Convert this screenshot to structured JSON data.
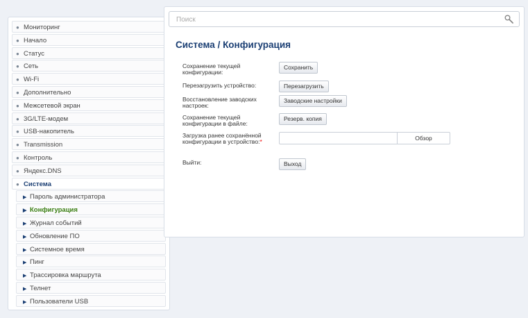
{
  "sidebar": {
    "items": [
      {
        "label": "Мониторинг"
      },
      {
        "label": "Начало"
      },
      {
        "label": "Статус"
      },
      {
        "label": "Сеть"
      },
      {
        "label": "Wi-Fi"
      },
      {
        "label": "Дополнительно"
      },
      {
        "label": "Межсетевой экран"
      },
      {
        "label": "3G/LTE-модем"
      },
      {
        "label": "USB-накопитель"
      },
      {
        "label": "Transmission"
      },
      {
        "label": "Контроль"
      },
      {
        "label": "Яндекс.DNS"
      },
      {
        "label": "Система"
      },
      {
        "label": "Пароль администратора"
      },
      {
        "label": "Конфигурация"
      },
      {
        "label": "Журнал событий"
      },
      {
        "label": "Обновление ПО"
      },
      {
        "label": "Системное время"
      },
      {
        "label": "Пинг"
      },
      {
        "label": "Трассировка маршрута"
      },
      {
        "label": "Телнет"
      },
      {
        "label": "Пользователи USB"
      }
    ]
  },
  "search": {
    "placeholder": "Поиск"
  },
  "page": {
    "title": "Система /  Конфигурация"
  },
  "form": {
    "save_label": "Сохранение текущей конфигурации:",
    "save_button": "Сохранить",
    "reboot_label": "Перезагрузить устройство:",
    "reboot_button": "Перезагрузить",
    "factory_label": "Восстановление заводских настроек:",
    "factory_button": "Заводские настройки",
    "backup_label": "Сохранение текущей конфигурации в файле:",
    "backup_button": "Резерв. копия",
    "upload_label": "Загрузка ранее сохранённой конфигурации в устройство:",
    "upload_required": "*",
    "browse_button": "Обзор",
    "logout_label": "Выйти:",
    "logout_button": "Выход"
  },
  "colors": {
    "title": "#1a3e73",
    "active_item": "#3a7e12",
    "required": "#ee0000"
  }
}
